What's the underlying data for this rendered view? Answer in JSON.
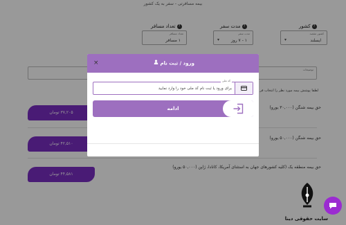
{
  "page": {
    "title": "بیمه مسافرتی - سفر به یک کشور"
  },
  "form": {
    "travelers": {
      "label": "تعداد مسافر",
      "badge": "?",
      "caption": "تعداد مسافر",
      "value": "۱ مسافر"
    },
    "duration": {
      "label": "مدت سفر",
      "badge": "?",
      "caption": "مدت سفر",
      "value": "۱ - ۷ روز"
    },
    "destination": {
      "label": "کشور",
      "badge": "?",
      "caption": "کشور مقصد",
      "value": "ایسلند"
    },
    "description": {
      "caption": "توضیحات"
    },
    "notice": "لطفا پوشش بیمه مورد نظر را انتخاب فر"
  },
  "plans": [
    {
      "label": "حق بیمه شنگن (۳۰,۰۰۰ یورو)",
      "price": "۳۷,۲۰۵ تومان"
    },
    {
      "label": "حق بیمه شنگن (۵۰,۰۰۰ یورو)",
      "price": "۴۲,۵۱۰ تومان"
    },
    {
      "label": "حق بیمه منطقه یک (کلیه کشورهای جهان به استثنای آمریکا، کانادا، ژاپن (۵۰,۰۰۰ یورو)",
      "price": "۴۴,۵۸۱ تومان"
    }
  ],
  "modal": {
    "title": "ورود / ثبت نام",
    "close": "×",
    "id_caption": "کد ملی",
    "id_placeholder": "برای ورود یا ثبت نام کد ملی خود را وارد نمایید",
    "submit_label": "ادامه"
  },
  "watermark": {
    "text": "سایت حقوقی دینا"
  },
  "colors": {
    "accent": "#9d6fbf",
    "price_pill": "#7a2ec4",
    "chat_button": "#9b2bd1"
  },
  "icons": {
    "user": "user-icon",
    "close": "close-icon",
    "card": "id-card-icon",
    "login": "sign-in-icon",
    "chat": "chat-icon",
    "logo": "quill-pen-logo"
  }
}
